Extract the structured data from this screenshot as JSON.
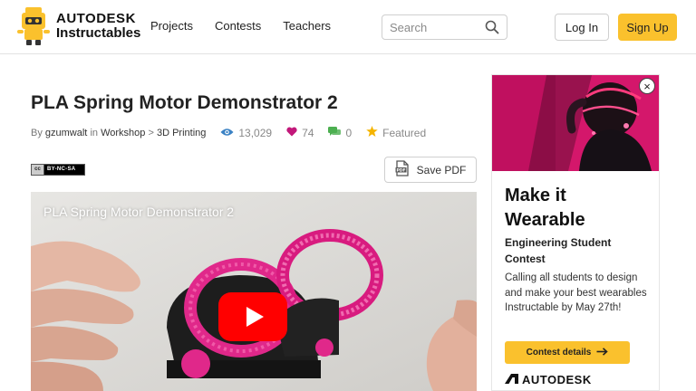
{
  "header": {
    "brand_line1": "AUTODESK",
    "brand_line2": "Instructables",
    "nav": [
      "Projects",
      "Contests",
      "Teachers"
    ],
    "search_placeholder": "Search",
    "login_label": "Log In",
    "signup_label": "Sign Up",
    "accent_color": "#fac12d"
  },
  "article": {
    "title": "PLA Spring Motor Demonstrator 2",
    "by_label": "By",
    "author": "gzumwalt",
    "in_label": "in",
    "category": "Workshop",
    "separator": ">",
    "subcategory": "3D Printing",
    "views": "13,029",
    "favorites": "74",
    "comments": "0",
    "featured_label": "Featured",
    "license_cc": "cc",
    "license_text": "BY-NC-SA",
    "save_pdf_label": "Save PDF",
    "video_title": "PLA Spring Motor Demonstrator 2"
  },
  "ad": {
    "headline_line1": "Make it",
    "headline_line2": "Wearable",
    "subheading": "Engineering Student Contest",
    "body": "Calling all students to design and make your best wearables Instructable by May 27th!",
    "button_label": "Contest details",
    "sponsor": "AUTODESK",
    "close_symbol": "×"
  },
  "icons": {
    "views": "eye-icon",
    "favorites": "heart-icon",
    "comments": "comment-icon",
    "featured": "star-icon",
    "search": "search-icon",
    "pdf": "pdf-icon",
    "play": "play-icon",
    "arrow": "arrow-right-icon"
  },
  "colors": {
    "views_icon": "#3b82c4",
    "heart_icon": "#c2187a",
    "comment_icon": "#4caf50",
    "star_icon": "#f5b400",
    "play_button": "#ff0000",
    "motor_pink": "#e0288a"
  }
}
